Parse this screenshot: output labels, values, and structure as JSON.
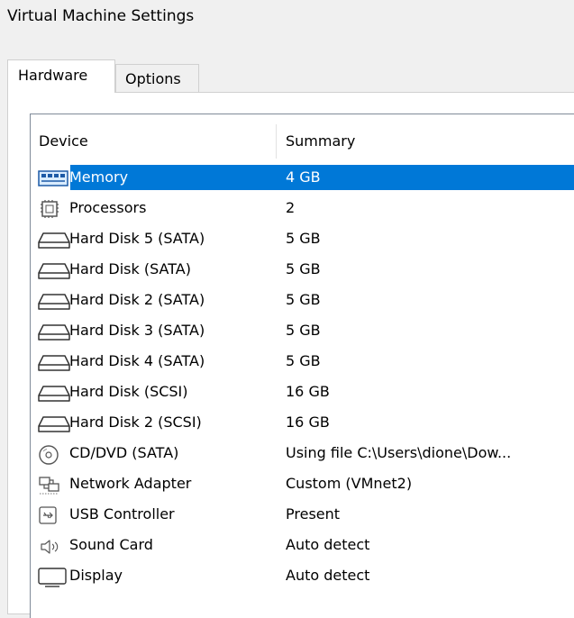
{
  "window": {
    "title": "Virtual Machine Settings"
  },
  "tabs": [
    {
      "label": "Hardware",
      "active": true
    },
    {
      "label": "Options",
      "active": false
    }
  ],
  "table": {
    "columns": [
      "Device",
      "Summary"
    ],
    "rows": [
      {
        "device": "Memory",
        "summary": "4 GB",
        "icon": "memory-icon",
        "selected": true
      },
      {
        "device": "Processors",
        "summary": "2",
        "icon": "processor-icon"
      },
      {
        "device": "Hard Disk 5 (SATA)",
        "summary": "5 GB",
        "icon": "hard-disk-icon"
      },
      {
        "device": "Hard Disk (SATA)",
        "summary": "5 GB",
        "icon": "hard-disk-icon"
      },
      {
        "device": "Hard Disk 2 (SATA)",
        "summary": "5 GB",
        "icon": "hard-disk-icon"
      },
      {
        "device": "Hard Disk 3 (SATA)",
        "summary": "5 GB",
        "icon": "hard-disk-icon"
      },
      {
        "device": "Hard Disk 4 (SATA)",
        "summary": "5 GB",
        "icon": "hard-disk-icon"
      },
      {
        "device": "Hard Disk (SCSI)",
        "summary": "16 GB",
        "icon": "hard-disk-icon"
      },
      {
        "device": "Hard Disk 2 (SCSI)",
        "summary": "16 GB",
        "icon": "hard-disk-icon"
      },
      {
        "device": "CD/DVD (SATA)",
        "summary": "Using file C:\\Users\\dione\\Dow...",
        "icon": "cd-dvd-icon"
      },
      {
        "device": "Network Adapter",
        "summary": "Custom (VMnet2)",
        "icon": "network-adapter-icon"
      },
      {
        "device": "USB Controller",
        "summary": "Present",
        "icon": "usb-icon"
      },
      {
        "device": "Sound Card",
        "summary": "Auto detect",
        "icon": "speaker-icon"
      },
      {
        "device": "Display",
        "summary": "Auto detect",
        "icon": "monitor-icon"
      }
    ]
  },
  "colors": {
    "selection": "#0078d7",
    "background": "#f0f0f0",
    "list_background": "#ffffff"
  }
}
